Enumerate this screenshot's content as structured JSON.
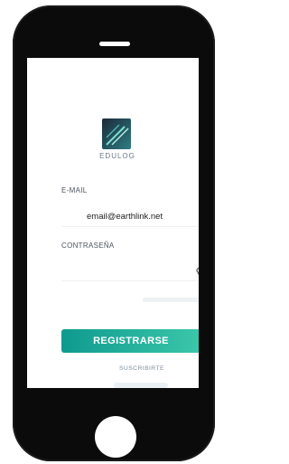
{
  "app": {
    "logo_text": "EDULOG"
  },
  "form": {
    "email_label": "E-MAIL",
    "email_value": "email@earthlink.net",
    "password_label": "CONTRASEÑA",
    "register_button": "REGISTRARSE",
    "secondary_link": "SUSCRIBIRTE"
  },
  "colors": {
    "accent_start": "#0f9a8f",
    "accent_end": "#3bc7a9",
    "frame": "#0b0b0c"
  },
  "icons": {
    "password_toggle": "eye-slash-icon"
  }
}
